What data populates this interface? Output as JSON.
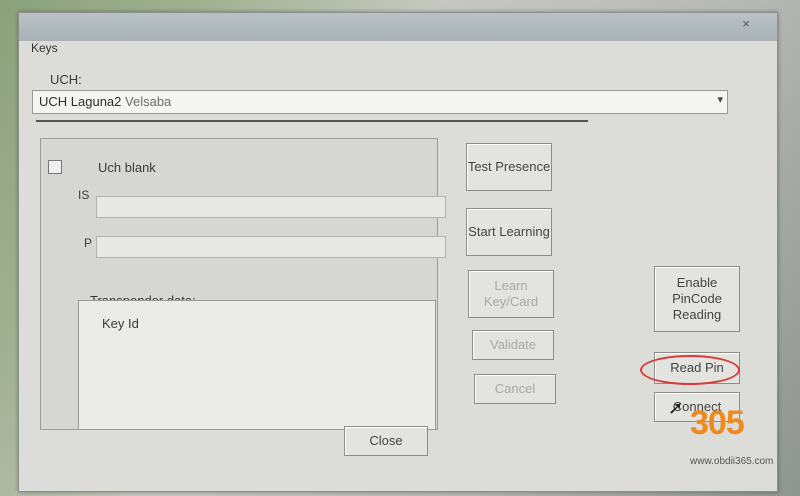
{
  "window": {
    "title": "Keys",
    "close_glyph": "×"
  },
  "uch": {
    "label": "UCH:",
    "selected": "UCH Laguna2",
    "selected_suffix": "Velsaba"
  },
  "panel": {
    "uch_blank_label": "Uch blank",
    "is_label": "IS",
    "pin_label": "P",
    "transponder_label": "Transponder data:",
    "key_id_label": "Key Id"
  },
  "buttons": {
    "test_presence": "Test Presence",
    "start_learning": "Start Learning",
    "learn_keycard": "Learn Key/Card",
    "validate": "Validate",
    "cancel": "Cancel",
    "enable_pincode": "Enable PinCode Reading",
    "read_pin": "Read Pin",
    "connect": "Connect",
    "close": "Close"
  },
  "watermark": {
    "logo": "305",
    "url": "www.obdii365.com",
    "accent": "#f08a1c"
  }
}
